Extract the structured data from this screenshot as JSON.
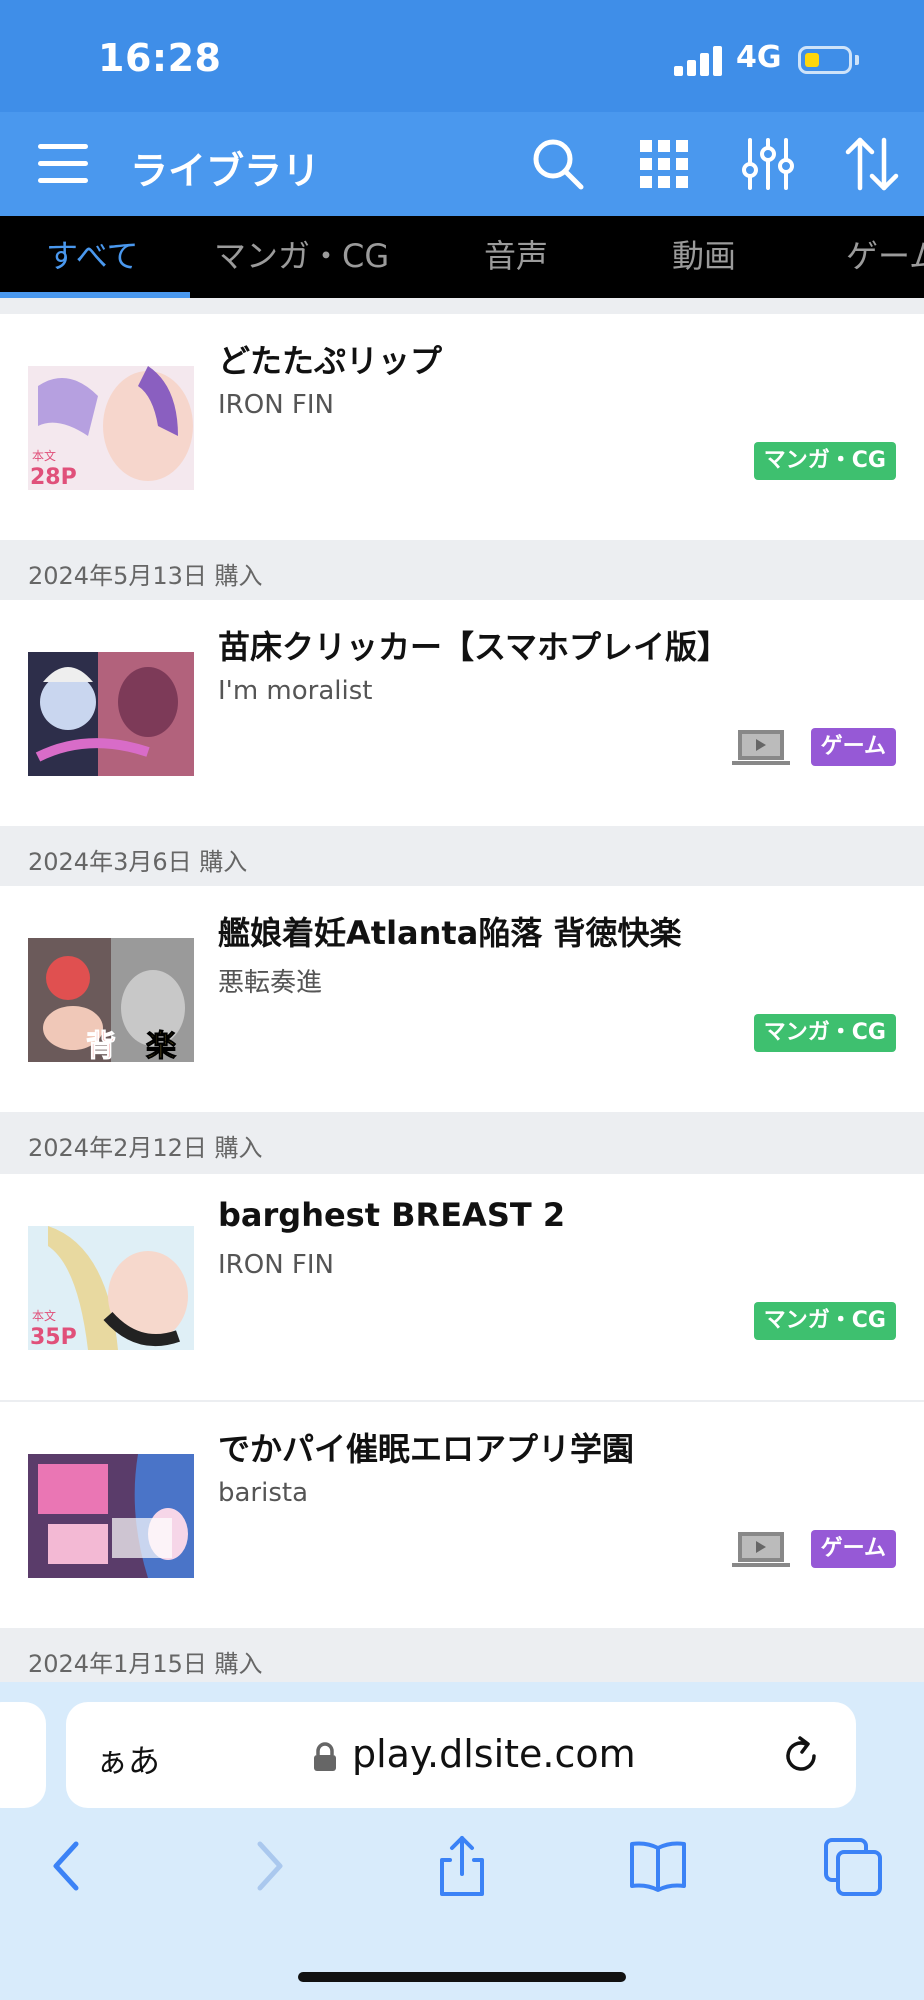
{
  "status_bar": {
    "time": "16:28",
    "network": "4G",
    "battery_level": 0.35
  },
  "header": {
    "title": "ライブラリ"
  },
  "tabs": [
    {
      "label": "すべて",
      "active": true
    },
    {
      "label": "マンガ・CG"
    },
    {
      "label": "音声"
    },
    {
      "label": "動画"
    },
    {
      "label": "ゲーム"
    }
  ],
  "items": [
    {
      "title": "どたたぷリップ",
      "author": "IRON FIN",
      "category": "マンガ・CG",
      "device_icon": false
    },
    {
      "title": "苗床クリッカー【スマホプレイ版】",
      "author": "I'm moralist",
      "category": "ゲーム",
      "device_icon": true
    },
    {
      "title": "艦娘着妊Atlanta陥落 背徳快楽",
      "author": "悪転奏進",
      "category": "マンガ・CG",
      "device_icon": false
    },
    {
      "title": "barghest BREAST 2",
      "author": "IRON FIN",
      "category": "マンガ・CG",
      "device_icon": false
    },
    {
      "title": "でかパイ催眠エロアプリ学園",
      "author": "barista",
      "category": "ゲーム",
      "device_icon": true
    }
  ],
  "purchase_dates": [
    "2024年5月13日 購入",
    "2024年3月6日 購入",
    "2024年2月12日 購入",
    "2024年1月15日 購入"
  ],
  "browser": {
    "text_size_label": "ぁあ",
    "url": "play.dlsite.com"
  },
  "colors": {
    "header_blue": "#4a98ee",
    "tab_active": "#4a98ee",
    "manga_badge": "#3ec06f",
    "game_badge": "#9659d6"
  }
}
